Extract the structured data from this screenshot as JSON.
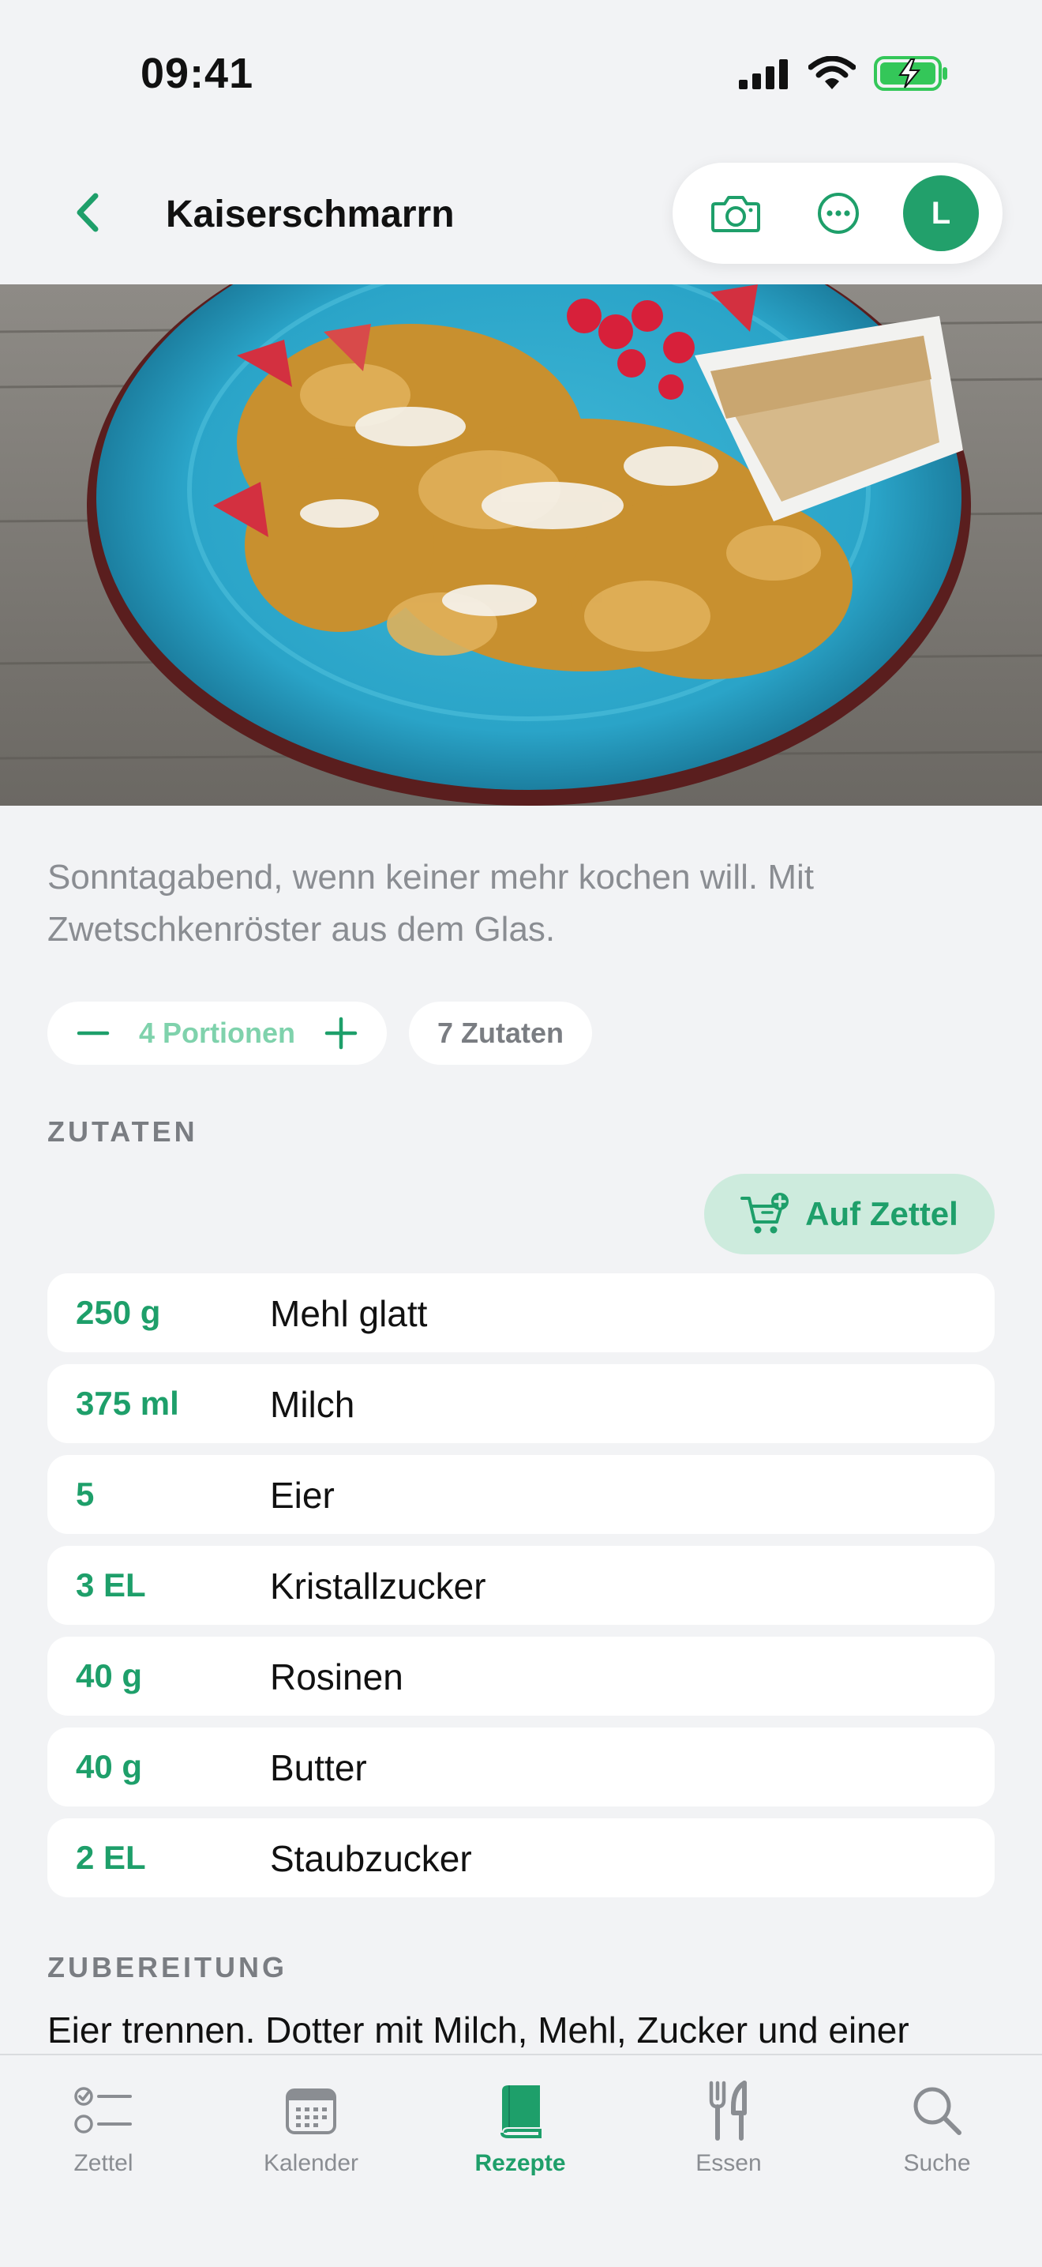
{
  "status": {
    "time": "09:41"
  },
  "nav": {
    "title": "Kaiserschmarrn",
    "avatar_initial": "L"
  },
  "recipe": {
    "description": "Sonntagabend, wenn keiner mehr kochen will. Mit Zwetschkenröster aus dem Glas.",
    "servings_label": "4 Portionen",
    "ingredients_count_label": "7 Zutaten"
  },
  "ingredients_section": {
    "heading": "ZUTATEN",
    "add_button_label": "Auf Zettel",
    "items": [
      {
        "amount": "250 g",
        "name": "Mehl glatt"
      },
      {
        "amount": "375 ml",
        "name": "Milch"
      },
      {
        "amount": "5",
        "name": "Eier"
      },
      {
        "amount": "3 EL",
        "name": "Kristallzucker"
      },
      {
        "amount": "40 g",
        "name": "Rosinen"
      },
      {
        "amount": "40 g",
        "name": "Butter"
      },
      {
        "amount": "2 EL",
        "name": "Staubzucker"
      }
    ]
  },
  "preparation": {
    "heading": "ZUBEREITUNG",
    "text": "Eier trennen. Dotter mit Milch, Mehl, Zucker und einer"
  },
  "tabbar": {
    "tabs": [
      {
        "label": "Zettel",
        "icon": "checklist-icon"
      },
      {
        "label": "Kalender",
        "icon": "calendar-icon"
      },
      {
        "label": "Rezepte",
        "icon": "book-icon",
        "active": true
      },
      {
        "label": "Essen",
        "icon": "fork-knife-icon"
      },
      {
        "label": "Suche",
        "icon": "search-icon"
      }
    ]
  },
  "colors": {
    "accent": "#1E9F6A",
    "accent_light": "#CDEBDD",
    "background": "#F2F3F5",
    "muted_text": "#8A8D92"
  }
}
